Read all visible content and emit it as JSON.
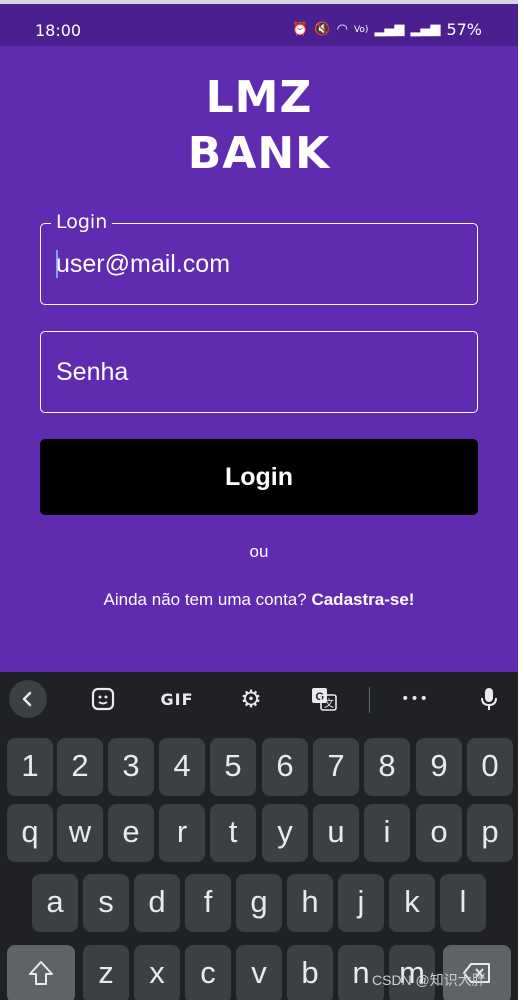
{
  "status_bar": {
    "time": "18:00",
    "icons": [
      "alarm-icon",
      "mute-icon",
      "wifi-icon",
      "volte-icon",
      "signal-icon",
      "signal-icon-2"
    ],
    "battery": "57%"
  },
  "app": {
    "logo_line1": "LMZ",
    "logo_line2": "BANK",
    "login_field": {
      "label": "Login",
      "value": "user@mail.com"
    },
    "password_field": {
      "placeholder": "Senha"
    },
    "login_button": "Login",
    "or_text": "ou",
    "signup_prompt": "Ainda não tem uma conta?",
    "signup_link": "Cadastra-se!"
  },
  "keyboard": {
    "toolbar": {
      "gif_label": "GIF",
      "more_label": "•••"
    },
    "row_numbers": [
      "1",
      "2",
      "3",
      "4",
      "5",
      "6",
      "7",
      "8",
      "9",
      "0"
    ],
    "row_top": [
      "q",
      "w",
      "e",
      "r",
      "t",
      "y",
      "u",
      "i",
      "o",
      "p"
    ],
    "row_middle": [
      "a",
      "s",
      "d",
      "f",
      "g",
      "h",
      "j",
      "k",
      "l"
    ],
    "row_bottom": [
      "z",
      "x",
      "c",
      "v",
      "b",
      "n",
      "m"
    ]
  },
  "watermark": "CSDN @知识大胖",
  "colors": {
    "app_bg": "#5f2bb0",
    "status_bg": "#4a2090",
    "button_bg": "#000000",
    "keyboard_bg": "#202124",
    "key_bg": "#3c4043"
  }
}
